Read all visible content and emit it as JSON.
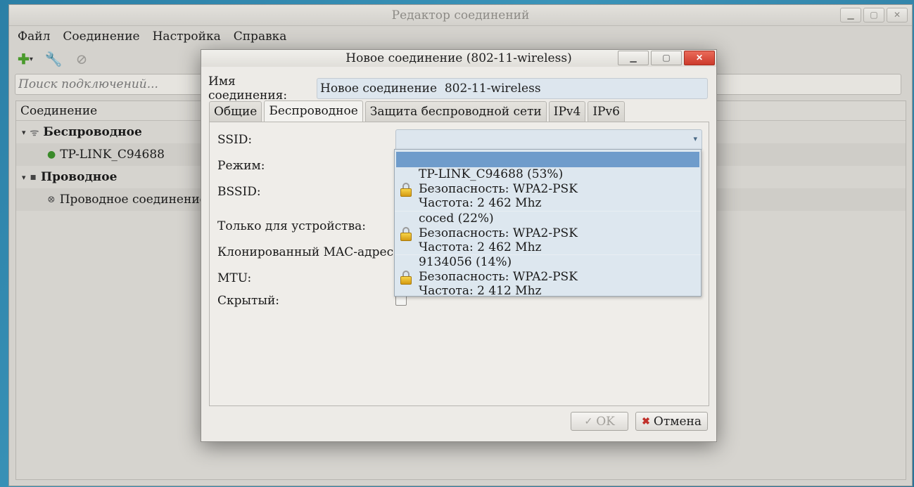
{
  "main_window": {
    "title": "Редактор соединений",
    "menu": [
      "Файл",
      "Соединение",
      "Настройка",
      "Справка"
    ],
    "search_placeholder": "Поиск подключений...",
    "list_header": "Соединение",
    "groups": [
      {
        "label": "Беспроводное",
        "items": [
          "TP-LINK_C94688"
        ]
      },
      {
        "label": "Проводное",
        "items": [
          "Проводное соединение"
        ]
      }
    ]
  },
  "dialog": {
    "title": "Новое соединение (802-11-wireless)",
    "name_label": "Имя соединения:",
    "name_value": "Новое соединение  802-11-wireless",
    "tabs": [
      "Общие",
      "Беспроводное",
      "Защита беспроводной сети",
      "IPv4",
      "IPv6"
    ],
    "active_tab": "Беспроводное",
    "fields": {
      "ssid": "SSID:",
      "mode": "Режим:",
      "bssid": "BSSID:",
      "device_only": "Только для устройства:",
      "cloned_mac": "Клонированный MAC-адрес:",
      "mtu": "MTU:",
      "hidden": "Скрытый:"
    },
    "ssid_dropdown": [
      {
        "line1": "TP-LINK_C94688 (53%)",
        "line2": "Безопасность: WPA2-PSK",
        "line3": "Частота: 2 462 Mhz"
      },
      {
        "line1": "coced (22%)",
        "line2": "Безопасность: WPA2-PSK",
        "line3": "Частота: 2 462 Mhz"
      },
      {
        "line1": "9134056 (14%)",
        "line2": "Безопасность: WPA2-PSK",
        "line3": "Частота: 2 412 Mhz"
      }
    ],
    "buttons": {
      "ok": "OK",
      "cancel": "Отмена"
    }
  },
  "colors": {
    "dropdown_selection": "#6f9ccb",
    "close_button": "#cc3a2b"
  }
}
